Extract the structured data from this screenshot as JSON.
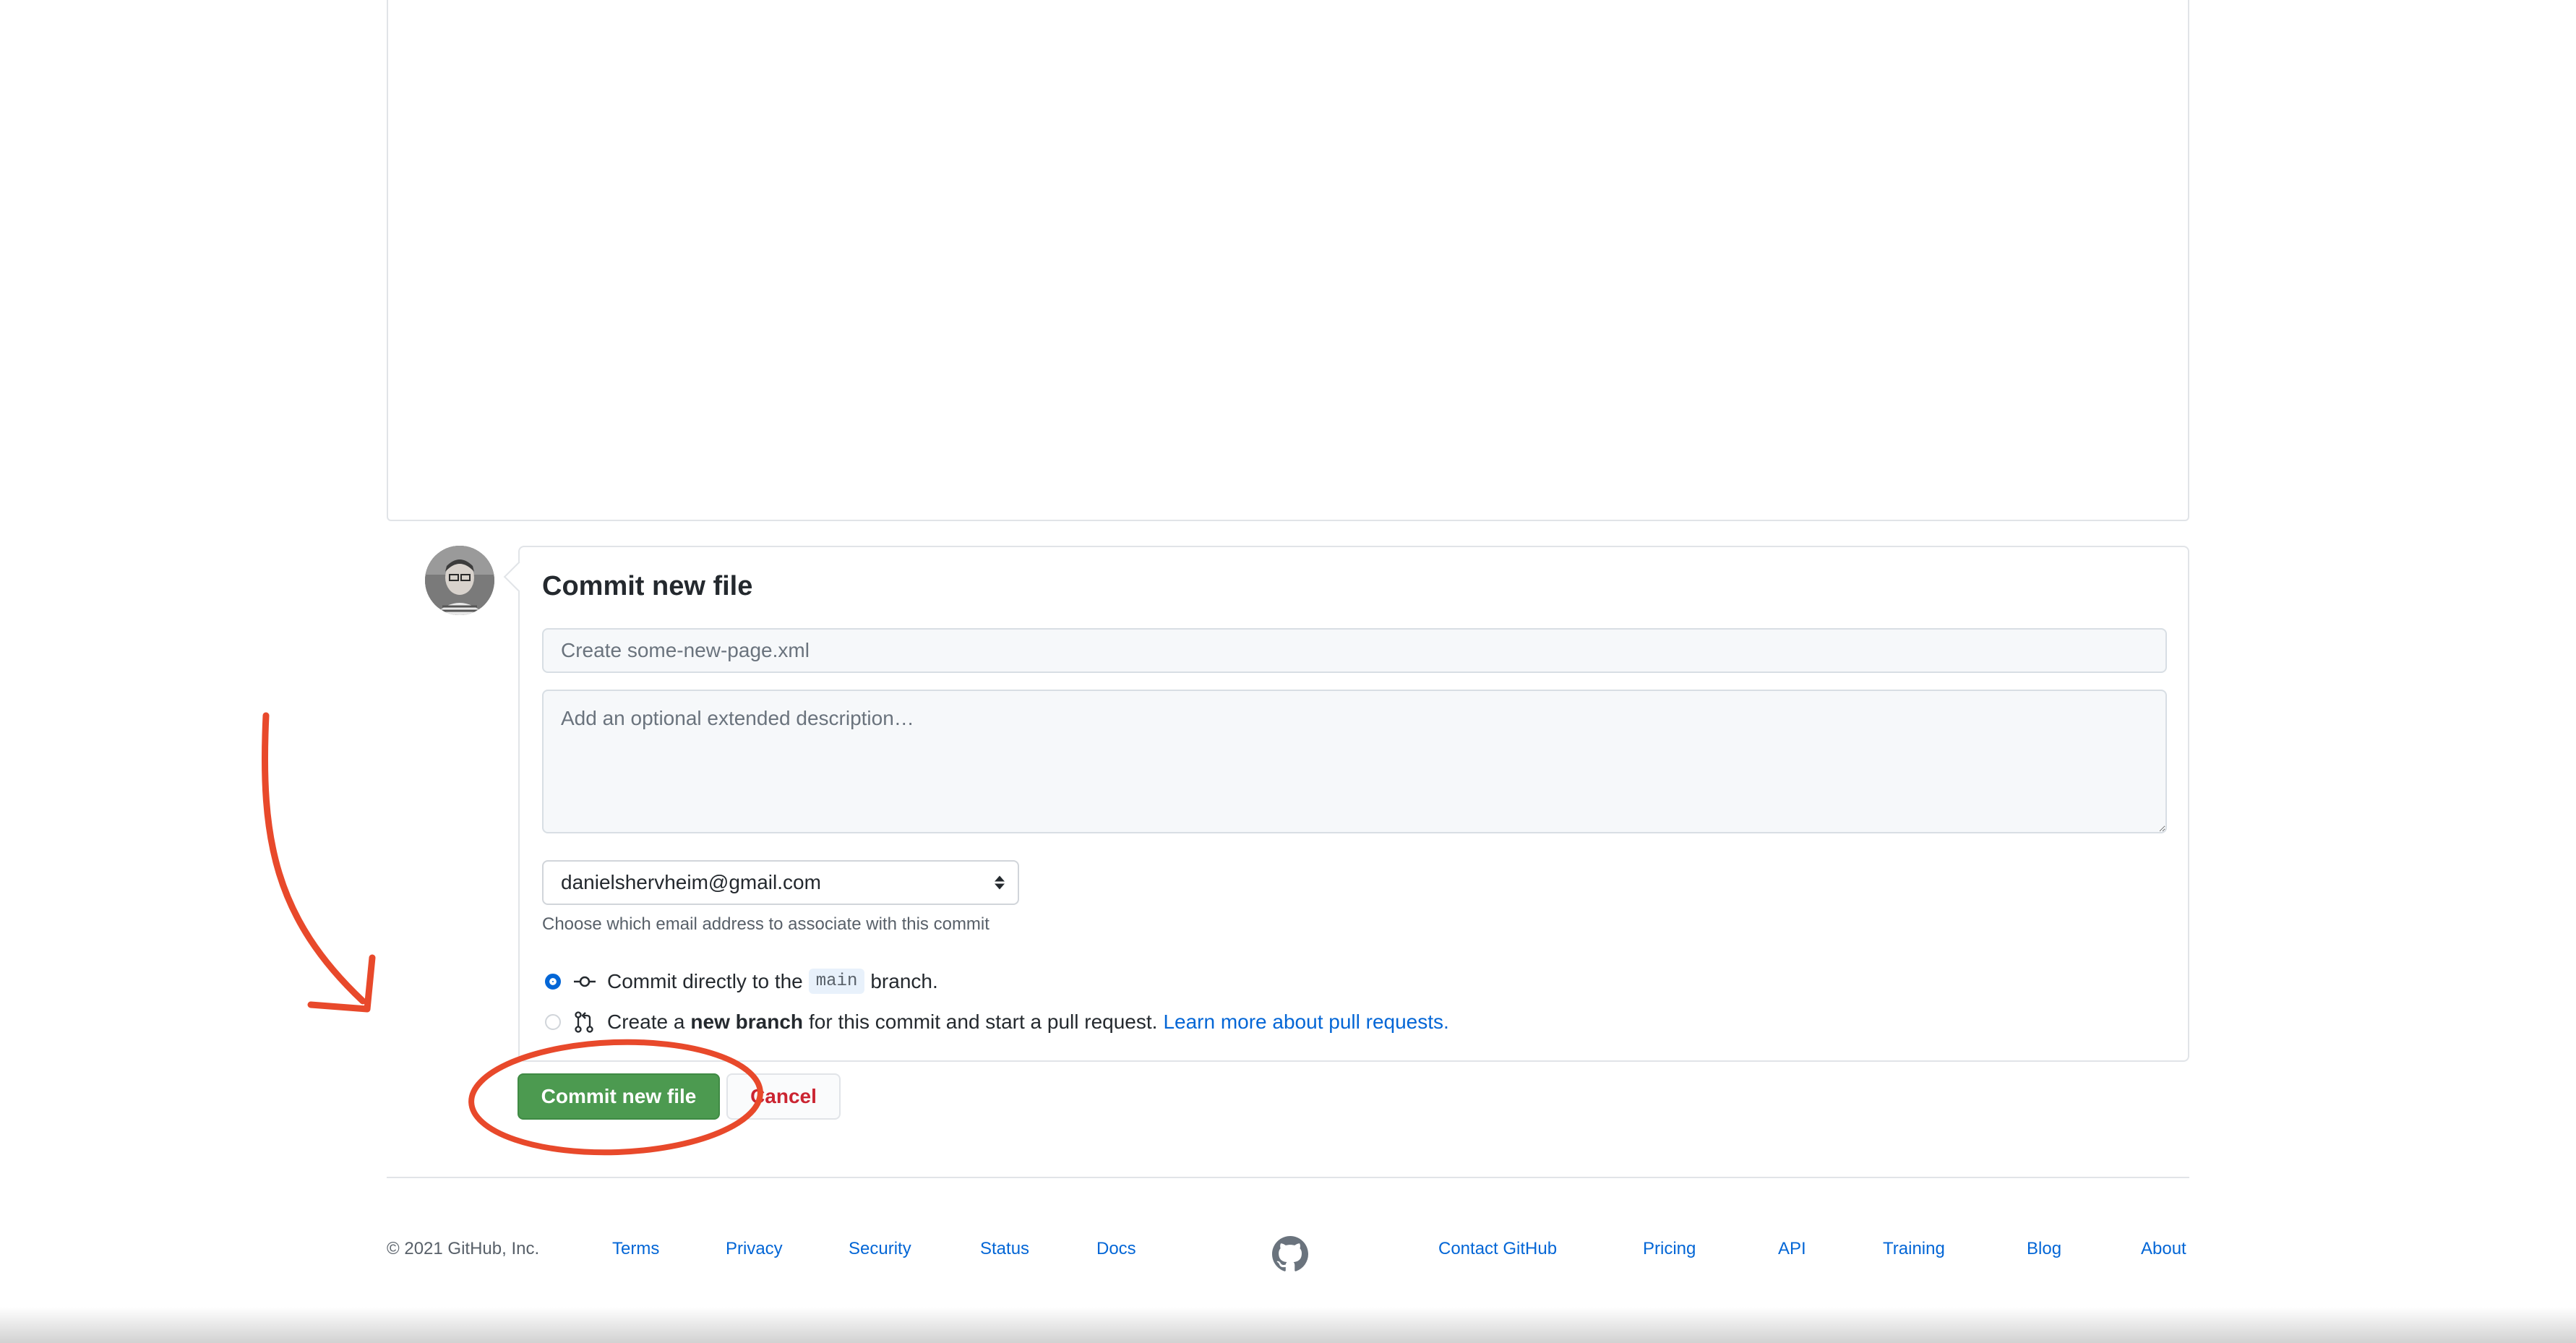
{
  "commit": {
    "title": "Commit new file",
    "summary_placeholder": "Create some-new-page.xml",
    "description_placeholder": "Add an optional extended description…",
    "email_selected": "danielshervheim@gmail.com",
    "email_note": "Choose which email address to associate with this commit",
    "option_direct": {
      "prefix": "Commit directly to the",
      "branch": "main",
      "suffix": "branch."
    },
    "option_new_branch": {
      "prefix": "Create a",
      "bold": "new branch",
      "suffix": "for this commit and start a pull request.",
      "link": "Learn more about pull requests."
    },
    "commit_button": "Commit new file",
    "cancel_button": "Cancel"
  },
  "footer": {
    "copyright": "© 2021 GitHub, Inc.",
    "left_links": [
      "Terms",
      "Privacy",
      "Security",
      "Status",
      "Docs"
    ],
    "right_links": [
      "Contact GitHub",
      "Pricing",
      "API",
      "Training",
      "Blog",
      "About"
    ]
  },
  "colors": {
    "commit_button": "#4c9a50",
    "cancel_text": "#cb2431",
    "link": "#0366d6",
    "annotation": "#e8492b"
  },
  "icons": {
    "avatar": "user-avatar",
    "direct": "git-commit-icon",
    "new_branch": "git-pull-request-icon",
    "footer_logo": "github-mark-icon"
  }
}
